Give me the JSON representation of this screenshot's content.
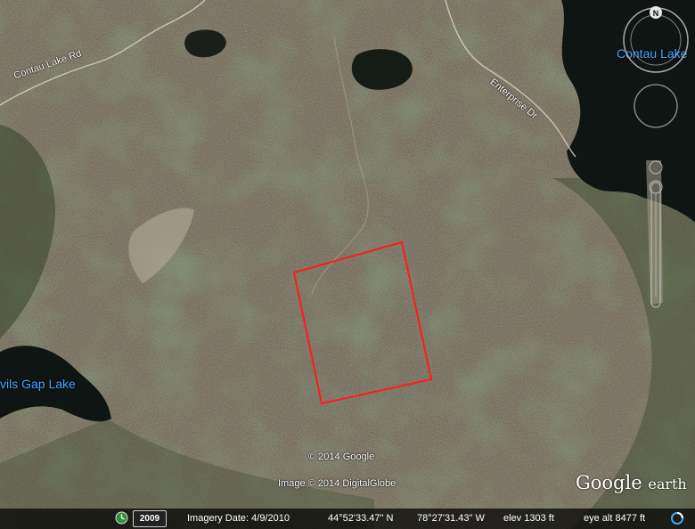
{
  "map": {
    "lakes": {
      "contau": "Contau Lake",
      "devils_gap": "vils Gap Lake"
    },
    "roads": {
      "contau_lake_rd": "Contau Lake Rd",
      "enterprise_dr": "Enterprise Dr"
    },
    "overlay": {
      "shape": "red outlined parcel",
      "color": "#ff1a1a"
    }
  },
  "credits": {
    "copyright": "© 2014 Google",
    "imagery": "Image © 2014 DigitalGlobe"
  },
  "brand": {
    "name": "Google",
    "suffix": "earth"
  },
  "navigation": {
    "compass_letter": "N"
  },
  "status": {
    "year": "2009",
    "imagery_date": "Imagery Date: 4/9/2010",
    "lat": "44°52'33.47\" N",
    "lon": "78°27'31.43\" W",
    "elev": "elev  1303 ft",
    "eye_alt": "eye alt  8477 ft"
  },
  "colors": {
    "terrain_base": "#6b6253",
    "forest": "#3a4a2e",
    "water": "#0f1512",
    "overlay": "#ff1a1a",
    "lake_label": "#4aa6ff"
  }
}
